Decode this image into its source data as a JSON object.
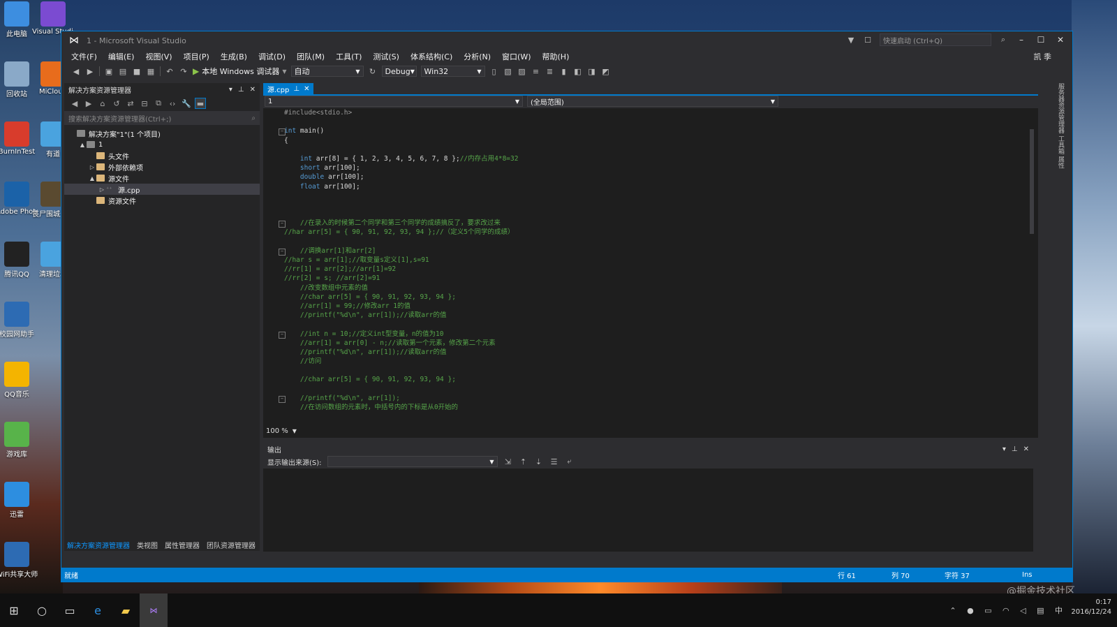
{
  "window": {
    "title": "1 - Microsoft Visual Studio",
    "quick_launch_placeholder": "快速启动 (Ctrl+Q)",
    "user": "凯 季"
  },
  "desktop_icons": [
    "此电脑",
    "Visual Studio",
    "回收站",
    "MiCloud",
    "BurnInTest",
    "有道",
    "Adobe Photosho...",
    "丧尸围城天启版",
    "腾讯QQ",
    "清理垃圾",
    "校园网助手",
    "QQ音乐",
    "游戏库",
    "迅雷",
    "WiFi共享大师"
  ],
  "menu": [
    "文件(F)",
    "编辑(E)",
    "视图(V)",
    "项目(P)",
    "生成(B)",
    "调试(D)",
    "团队(M)",
    "工具(T)",
    "测试(S)",
    "体系结构(C)",
    "分析(N)",
    "窗口(W)",
    "帮助(H)"
  ],
  "toolbar": {
    "run_label": "本地 Windows 调试器",
    "run_mode": "自动",
    "config": "Debug",
    "platform": "Win32"
  },
  "solution_explorer": {
    "title": "解决方案资源管理器",
    "search_placeholder": "搜索解决方案资源管理器(Ctrl+;)",
    "tree": [
      {
        "label": "解决方案\"1\"(1 个项目)",
        "level": 0
      },
      {
        "label": "1",
        "level": 1
      },
      {
        "label": "头文件",
        "level": 2
      },
      {
        "label": "外部依赖项",
        "level": 2
      },
      {
        "label": "源文件",
        "level": 2
      },
      {
        "label": "源.cpp",
        "level": 3
      },
      {
        "label": "资源文件",
        "level": 2
      }
    ],
    "tabs": [
      "解决方案资源管理器",
      "类视图",
      "属性管理器",
      "团队资源管理器"
    ]
  },
  "editor": {
    "tab": "源.cpp",
    "nav_left": "1",
    "nav_right": "(全局范围)",
    "zoom": "100 %",
    "lines": [
      "#include<stdio.h>",
      "",
      "int main()",
      "{",
      "",
      "    int arr[8] = { 1, 2, 3, 4, 5, 6, 7, 8 };//内存占用4*8=32",
      "    short arr[100];",
      "    double arr[100];",
      "    float arr[100];",
      "",
      "",
      "",
      "    //在录入的时候第二个同学和第三个同学的成绩搞反了，要求改过来",
      "//har arr[5] = { 90, 91, 92, 93, 94 };//（定义5个同学的成绩）",
      "",
      "    //调换arr[1]和arr[2]",
      "//har s = arr[1];//取变量s定义[1],s=91",
      "//rr[1] = arr[2];//arr[1]=92",
      "//rr[2] = s; //arr[2]=91",
      "    //改变数组中元素的值",
      "    //char arr[5] = { 90, 91, 92, 93, 94 };",
      "    //arr[1] = 99;//修改arr 1的值",
      "    //printf(\"%d\\n\", arr[1]);//读取arr的值",
      "",
      "    //int n = 10;//定义int型变量，n的值为10",
      "    //arr[1] = arr[0] - n;//读取第一个元素，修改第二个元素",
      "    //printf(\"%d\\n\", arr[1]);//读取arr的值",
      "    //访问",
      "",
      "    //char arr[5] = { 90, 91, 92, 93, 94 };",
      "",
      "    //printf(\"%d\\n\", arr[1]);",
      "    //在访问数组的元素时，中括号内的下标是从0开始的"
    ]
  },
  "output": {
    "title": "输出",
    "source_label": "显示输出来源(S):",
    "source_value": ""
  },
  "statusbar": {
    "ready": "就绪",
    "line": "行 61",
    "col": "列 70",
    "char": "字符 37",
    "mode": "Ins"
  },
  "right_rail": "服务器资源管理器 工具箱 属性",
  "taskbar": {
    "time": "0:17",
    "date": "2016/12/24",
    "ime": "中"
  },
  "watermark": "@掘金技术社区"
}
